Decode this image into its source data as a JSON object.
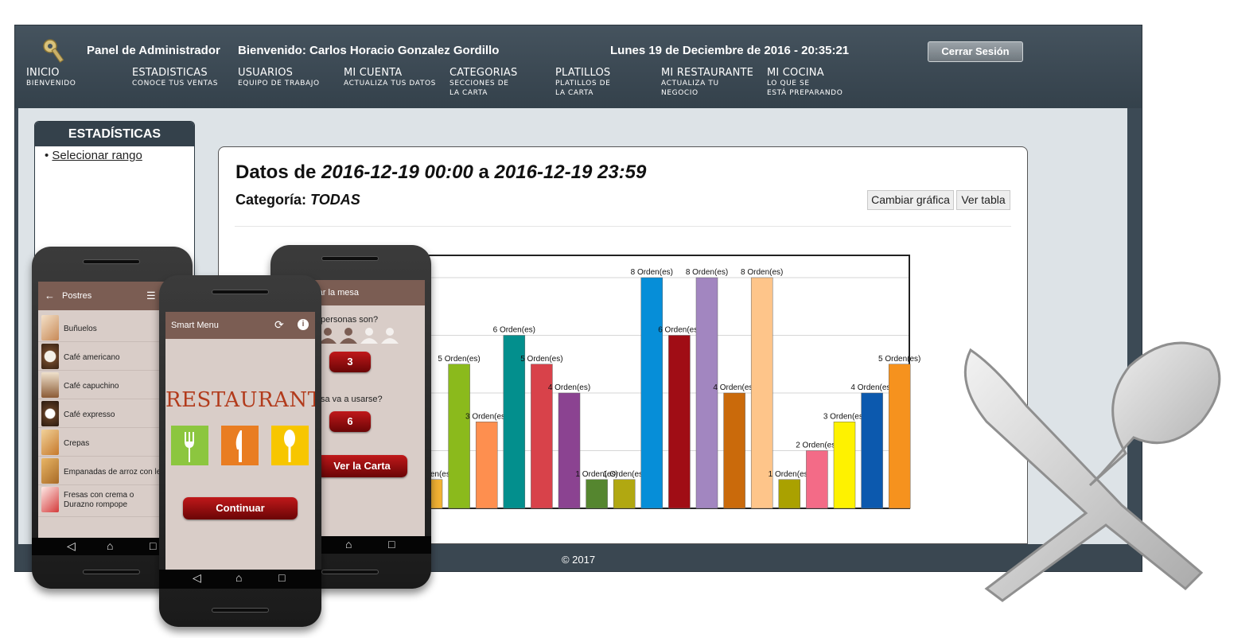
{
  "admin": {
    "panel_label": "Panel de Administrador",
    "welcome": "Bienvenido: Carlos Horacio Gonzalez Gordillo",
    "datetime": "Lunes 19 de Deciembre de 2016 - 20:35:21",
    "logout_label": "Cerrar Sesión",
    "nav": [
      {
        "title": "INICIO",
        "sub": "BIENVENIDO"
      },
      {
        "title": "ESTADISTICAS",
        "sub": "CONOCE TUS VENTAS"
      },
      {
        "title": "USUARIOS",
        "sub": "EQUIPO DE TRABAJO"
      },
      {
        "title": "MI CUENTA",
        "sub": "ACTUALIZA TUS DATOS"
      },
      {
        "title": "CATEGORIAS",
        "sub": "SECCIONES DE\nLA CARTA"
      },
      {
        "title": "PLATILLOS",
        "sub": "PLATILLOS DE\nLA CARTA"
      },
      {
        "title": "MI RESTAURANTE",
        "sub": "ACTUALIZA TU\nNEGOCIO"
      },
      {
        "title": "MI COCINA",
        "sub": "LO QUE SE\nESTÁ PREPARANDO"
      }
    ],
    "sidebar": {
      "title": "ESTADÍSTICAS",
      "link": "Selecionar rango"
    },
    "panel": {
      "title_prefix": "Datos de ",
      "date_from": "2016-12-19 00:00",
      "title_mid": " a ",
      "date_to": "2016-12-19 23:59",
      "category_label": "Categoría: ",
      "category_value": "TODAS",
      "change_chart_label": "Cambiar gráfica",
      "view_table_label": "Ver tabla"
    },
    "footer": "© 2017"
  },
  "chart_data": {
    "type": "bar",
    "ylim": [
      0,
      8
    ],
    "grid": true,
    "value_label_suffix": " Orden(es)",
    "bars": [
      {
        "value": 1,
        "color": "#f2b233"
      },
      {
        "value": 5,
        "color": "#8bba1c"
      },
      {
        "value": 3,
        "color": "#fe8f4f"
      },
      {
        "value": 6,
        "color": "#038f8d"
      },
      {
        "value": 5,
        "color": "#d8424a"
      },
      {
        "value": 4,
        "color": "#8b4391"
      },
      {
        "value": 1,
        "color": "#55862f"
      },
      {
        "value": 1,
        "color": "#b1a811"
      },
      {
        "value": 8,
        "color": "#068ed8"
      },
      {
        "value": 6,
        "color": "#a00d15"
      },
      {
        "value": 8,
        "color": "#a286c0"
      },
      {
        "value": 4,
        "color": "#ca6a0b"
      },
      {
        "value": 8,
        "color": "#fec58a"
      },
      {
        "value": 1,
        "color": "#aaa100"
      },
      {
        "value": 2,
        "color": "#f36b87"
      },
      {
        "value": 3,
        "color": "#fef200"
      },
      {
        "value": 4,
        "color": "#0c59ae"
      },
      {
        "value": 5,
        "color": "#f6921e"
      }
    ]
  },
  "phone1": {
    "title": "Postres",
    "items": [
      "Buñuelos",
      "Café americano",
      "Café capuchino",
      "Café expresso",
      "Crepas",
      "Empanadas de arroz con lec",
      "Fresas con crema o Durazno rompope"
    ]
  },
  "phone2": {
    "title": "Smart Menu",
    "brand": "RESTAURANT",
    "continue_label": "Continuar"
  },
  "phone3": {
    "title": "rar la mesa",
    "question1": "personas son?",
    "people_count": "3",
    "question2": "sa va a usarse?",
    "table_number": "6",
    "view_menu_label": "Ver la Carta"
  },
  "colors": {
    "header": "#3c4a55",
    "app_bar": "#7b5d53",
    "app_bg": "#d9cdc8",
    "accent_red": "#a80f12",
    "tile_green": "#8cc63f",
    "tile_orange": "#e97d22",
    "tile_yellow": "#f7c600"
  }
}
